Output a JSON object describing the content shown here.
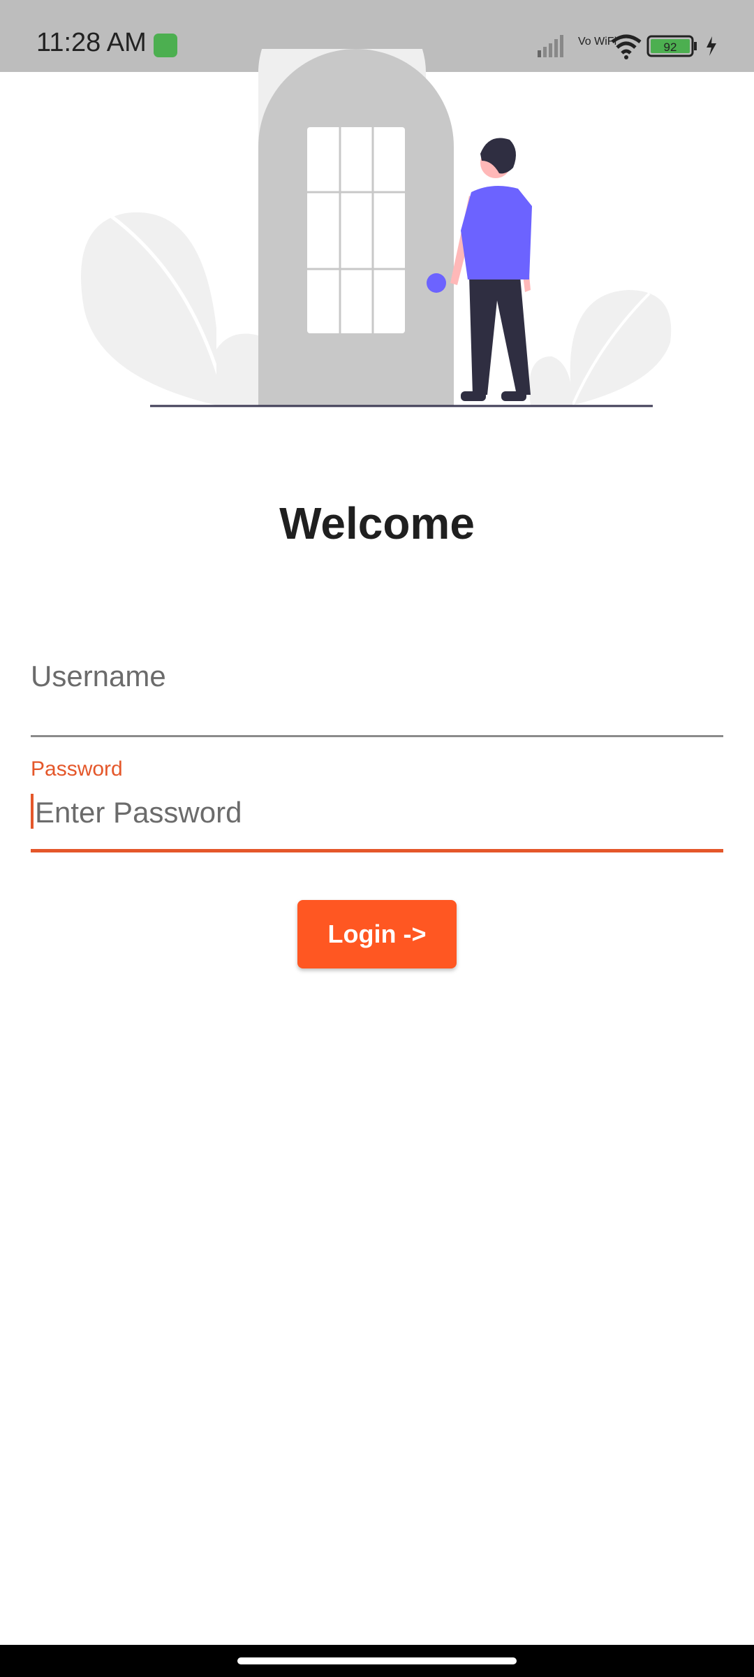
{
  "status_bar": {
    "time": "11:28 AM",
    "network_label": "Vo WiFi",
    "battery_level": "92",
    "icons": [
      "app-notification-icon",
      "signal-icon",
      "vowifi-icon",
      "wifi-icon",
      "battery-icon",
      "charging-icon"
    ]
  },
  "illustration": {
    "description_icon": "door-person-illustration"
  },
  "main": {
    "title": "Welcome",
    "username_placeholder": "Username",
    "password_label": "Password",
    "password_placeholder": "Enter Password",
    "login_button_label": "Login ->"
  },
  "colors": {
    "accent": "#ff5722",
    "focus": "#e4572a",
    "status_bar": "#bdbdbd",
    "text_primary": "#1f1f1f"
  }
}
